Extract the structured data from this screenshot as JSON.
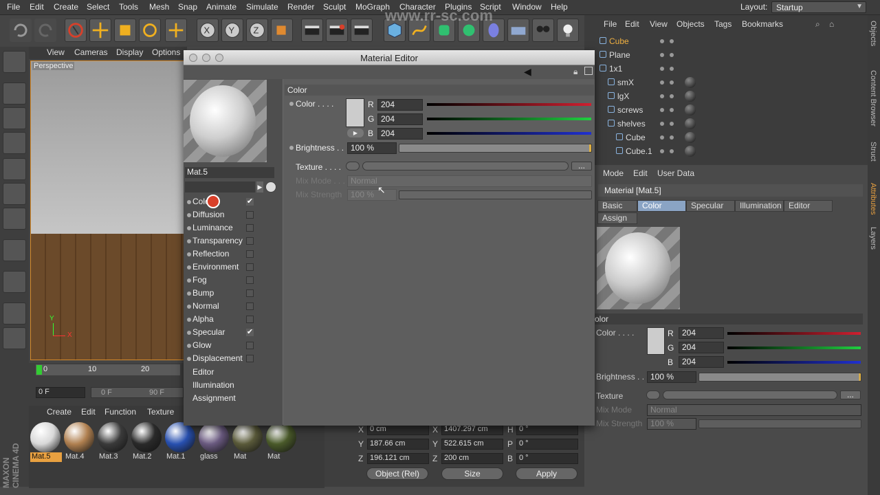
{
  "menubar": {
    "items": [
      "File",
      "Edit",
      "Create",
      "Select",
      "Tools",
      "Mesh",
      "Snap",
      "Animate",
      "Simulate",
      "Render",
      "Sculpt",
      "MoGraph",
      "Character",
      "Plugins",
      "Script",
      "Window",
      "Help"
    ],
    "layout_label": "Layout:",
    "layout_value": "Startup"
  },
  "watermark": "www.rr-sc.com",
  "viewport": {
    "menu": [
      "View",
      "Cameras",
      "Display",
      "Options"
    ],
    "label": "Perspective",
    "axis_y": "Y",
    "axis_x": "X"
  },
  "timeline": {
    "ticks": [
      "0",
      "10",
      "20"
    ],
    "start_field": "0 F",
    "range_start": "0 F",
    "range_end": "90 F"
  },
  "material_manager": {
    "menu": [
      "Create",
      "Edit",
      "Function",
      "Texture"
    ],
    "materials": [
      {
        "name": "Mat.5",
        "color": "#d8d8d8",
        "selected": true
      },
      {
        "name": "Mat.4",
        "color": "#b08050",
        "selected": false
      },
      {
        "name": "Mat.3",
        "color": "#3a3a3a",
        "selected": false
      },
      {
        "name": "Mat.2",
        "color": "#2a2a2a",
        "selected": false
      },
      {
        "name": "Mat.1",
        "color": "#2850b0",
        "selected": false
      },
      {
        "name": "glass",
        "color": "#6a5a80",
        "selected": false
      },
      {
        "name": "Mat",
        "color": "#5a5a3a",
        "selected": false
      },
      {
        "name": "Mat",
        "color": "#4a5a2a",
        "selected": false
      }
    ],
    "maxon": "MAXON CINEMA 4D"
  },
  "coordinates": {
    "x_pos": "0 cm",
    "y_pos": "187.66 cm",
    "z_pos": "196.121 cm",
    "x_size": "1407.297 cm",
    "y_size": "522.615 cm",
    "z_size": "200 cm",
    "h": "0 °",
    "p": "0 °",
    "b": "0 °",
    "labels": {
      "x": "X",
      "y": "Y",
      "z": "Z",
      "h": "H",
      "p": "P",
      "b": "B"
    },
    "object_mode": "Object (Rel)",
    "size_mode": "Size",
    "apply": "Apply"
  },
  "object_manager": {
    "menu": [
      "File",
      "Edit",
      "View",
      "Objects",
      "Tags",
      "Bookmarks"
    ],
    "rows": [
      {
        "name": "Cube",
        "indent": 0,
        "highlight": true
      },
      {
        "name": "Plane",
        "indent": 0,
        "highlight": false
      },
      {
        "name": "1x1",
        "indent": 0,
        "highlight": false
      },
      {
        "name": "smX",
        "indent": 1,
        "highlight": false
      },
      {
        "name": "lgX",
        "indent": 1,
        "highlight": false
      },
      {
        "name": "screws",
        "indent": 1,
        "highlight": false
      },
      {
        "name": "shelves",
        "indent": 1,
        "highlight": false
      },
      {
        "name": "Cube",
        "indent": 2,
        "highlight": false
      },
      {
        "name": "Cube.1",
        "indent": 2,
        "highlight": false
      }
    ]
  },
  "side_tabs": [
    "Objects",
    "Content Browser",
    "Struct",
    "Attributes",
    "Layers"
  ],
  "attributes": {
    "menu": [
      "Mode",
      "Edit",
      "User Data"
    ],
    "title": "Material [Mat.5]",
    "tabs": [
      "Basic",
      "Color",
      "Specular",
      "Illumination",
      "Editor"
    ],
    "active_tab": "Color",
    "assign_tab": "Assign",
    "section": "olor",
    "color_label": "Color . . . .",
    "r": "204",
    "g": "204",
    "b": "204",
    "brightness_label": "Brightness . .",
    "brightness": "100 %",
    "texture_label": "Texture",
    "mix_mode_label": "Mix Mode",
    "mix_mode": "Normal",
    "mix_strength_label": "Mix Strength",
    "mix_strength": "100 %",
    "texture_button": "..."
  },
  "material_editor": {
    "title": "Material Editor",
    "material_name": "Mat.5",
    "channels": [
      {
        "name": "Color",
        "checked": true
      },
      {
        "name": "Diffusion",
        "checked": false
      },
      {
        "name": "Luminance",
        "checked": false
      },
      {
        "name": "Transparency",
        "checked": false
      },
      {
        "name": "Reflection",
        "checked": false
      },
      {
        "name": "Environment",
        "checked": false
      },
      {
        "name": "Fog",
        "checked": false
      },
      {
        "name": "Bump",
        "checked": false
      },
      {
        "name": "Normal",
        "checked": false
      },
      {
        "name": "Alpha",
        "checked": false
      },
      {
        "name": "Specular",
        "checked": true
      },
      {
        "name": "Glow",
        "checked": false
      },
      {
        "name": "Displacement",
        "checked": false
      }
    ],
    "extra": [
      "Editor",
      "Illumination",
      "Assignment"
    ],
    "section": "Color",
    "color_label": "Color . . . .",
    "r_label": "R",
    "g_label": "G",
    "b_label": "B",
    "r": "204",
    "g": "204",
    "b": "204",
    "brightness_label": "Brightness . .",
    "brightness": "100 %",
    "texture_label": "Texture . . . .",
    "texture_button": "...",
    "mix_mode_label": "Mix Mode . . .",
    "mix_mode": "Normal",
    "mix_strength_label": "Mix Strength",
    "mix_strength": "100 %"
  },
  "colors": {
    "accent": "#d88b2a",
    "tab_active": "#8aa4c4",
    "red": "#c0202a",
    "green": "#20c040",
    "blue": "#2030d0"
  }
}
